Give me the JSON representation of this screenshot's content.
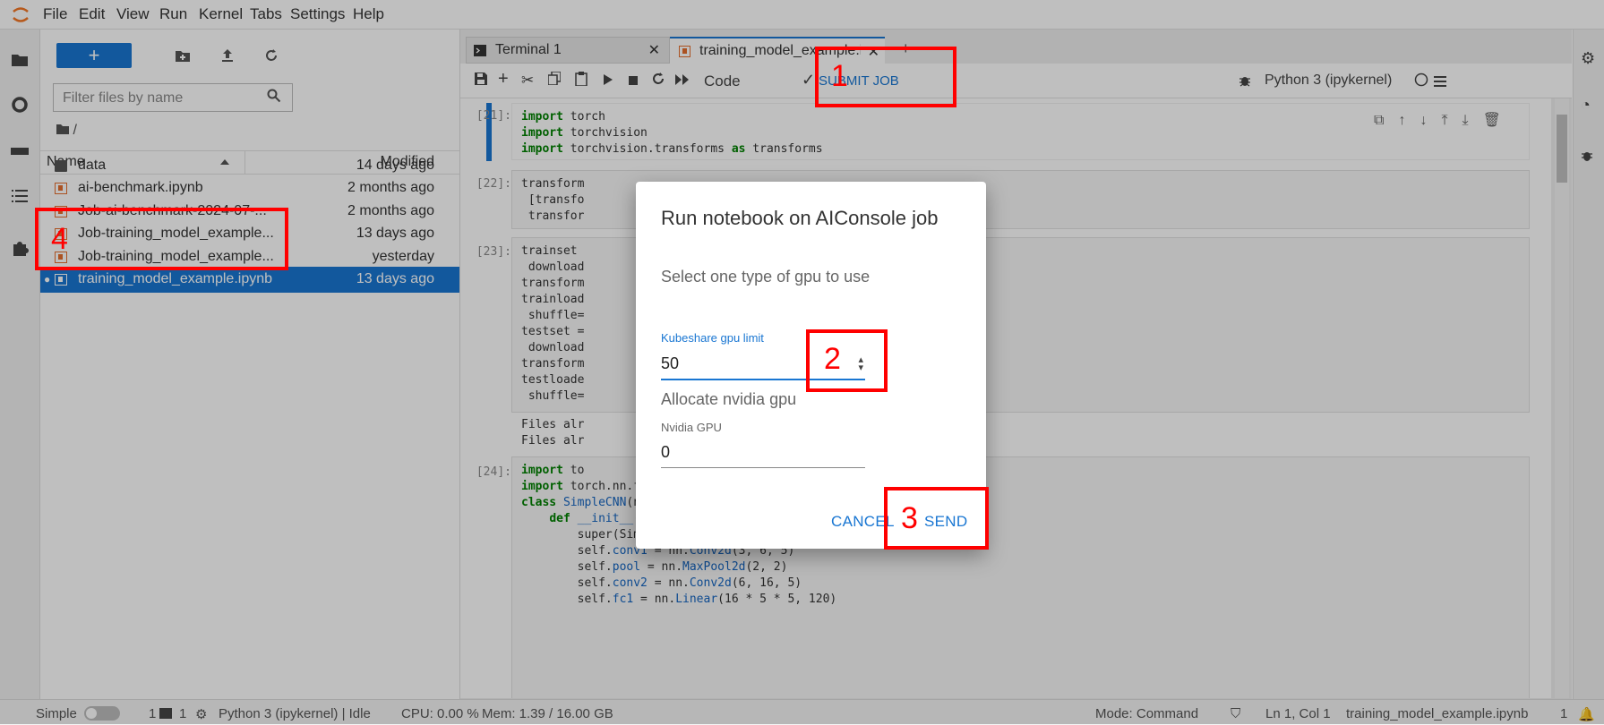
{
  "menubar": {
    "items": [
      "File",
      "Edit",
      "View",
      "Run",
      "Kernel",
      "Tabs",
      "Settings",
      "Help"
    ]
  },
  "filebrowser": {
    "filter_placeholder": "Filter files by name",
    "breadcrumb": "/",
    "col_name": "Name",
    "col_modified": "Modified",
    "files": [
      {
        "name": "data",
        "modified": "14 days ago",
        "type": "folder"
      },
      {
        "name": "ai-benchmark.ipynb",
        "modified": "2 months ago",
        "type": "notebook"
      },
      {
        "name": "Job-ai-benchmark-2024-07-...",
        "modified": "2 months ago",
        "type": "notebook"
      },
      {
        "name": "Job-training_model_example...",
        "modified": "13 days ago",
        "type": "notebook"
      },
      {
        "name": "Job-training_model_example...",
        "modified": "yesterday",
        "type": "notebook"
      },
      {
        "name": "training_model_example.ipynb",
        "modified": "13 days ago",
        "type": "notebook",
        "selected": true
      }
    ]
  },
  "tabs": [
    {
      "label": "Terminal 1"
    },
    {
      "label": "training_model_example.ipynb"
    }
  ],
  "toolbar": {
    "cell_type": "Code",
    "submit_job": "SUBMIT JOB",
    "kernel": "Python 3 (ipykernel)"
  },
  "cells": [
    {
      "prompt": "[21]:"
    },
    {
      "prompt": "[22]:"
    },
    {
      "prompt": "[23]:"
    },
    {
      "prompt": "[24]:"
    }
  ],
  "outputs": [
    "Files alr",
    "Files alr"
  ],
  "dialog": {
    "title": "Run notebook on AIConsole job",
    "subtitle": "Select one type of gpu to use",
    "kubeshare_label": "Kubeshare gpu limit",
    "kubeshare_value": "50",
    "allocate_label": "Allocate nvidia gpu",
    "nvidia_label": "Nvidia GPU",
    "nvidia_value": "0",
    "cancel": "CANCEL",
    "send": "SEND"
  },
  "annotations": [
    "1",
    "2",
    "3",
    "4"
  ],
  "statusbar": {
    "mode_label": "Simple",
    "count1": "1",
    "count2": "1",
    "kernel_status": "Python 3 (ipykernel) | Idle",
    "cpu": "CPU: 0.00 %",
    "mem": "Mem: 1.39 / 16.00 GB",
    "mode": "Mode: Command",
    "position": "Ln 1, Col 1",
    "filename": "training_model_example.ipynb",
    "notifications": "1"
  },
  "colors": {
    "accent": "#1976d2",
    "annotation": "#ff0000",
    "notebook_icon": "#e46e2e"
  }
}
